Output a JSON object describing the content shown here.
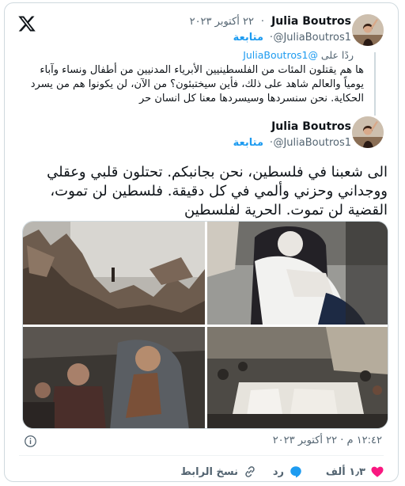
{
  "quoted_tweet": {
    "author_name": "Julia Boutros",
    "handle": "@JuliaBoutros1",
    "separator": "·",
    "date": "٢٢ أكتوبر ٢٠٢٣",
    "follow_label": "متابعة",
    "replying_label": "ردًا على",
    "replying_handle": "@JuliaBoutros1",
    "text": "ها هم يقتلون المئات من الفلسطينيين الأبرياء المدنيين من أطفال ونساء وآباء يومياً والعالم شاهد على ذلك، فأين سيختبئون؟ من الآن، لن يكونوا هم من يسرد الحكاية. نحن سنسردها وسيسردها معنا كل انسان حر"
  },
  "main_tweet": {
    "author_name": "Julia Boutros",
    "handle": "@JuliaBoutros1",
    "separator": "·",
    "follow_label": "متابعة",
    "text": "الى شعبنا في فلسطين، نحن بجانبكم. تحتلون قلبي وعقلي ووجداني وحزني وألمي في كل دقيقة. فلسطين لن تموت، القضية لن تموت. الحرية لفلسطين",
    "timestamp": "١٢:٤٢ م · ٢٢ أكتوبر ٢٠٢٣"
  },
  "actions": {
    "like_count": "١٫٣ ألف",
    "reply_label": "رد",
    "copy_link_label": "نسخ الرابط"
  },
  "icons": {
    "logo": "x-logo-icon",
    "info": "info-icon",
    "like": "heart-icon",
    "reply": "reply-bubble-icon",
    "copy": "link-icon"
  },
  "colors": {
    "accent": "#1d9bf0",
    "like": "#f91880",
    "muted": "#536471",
    "border": "#cfd9de"
  }
}
